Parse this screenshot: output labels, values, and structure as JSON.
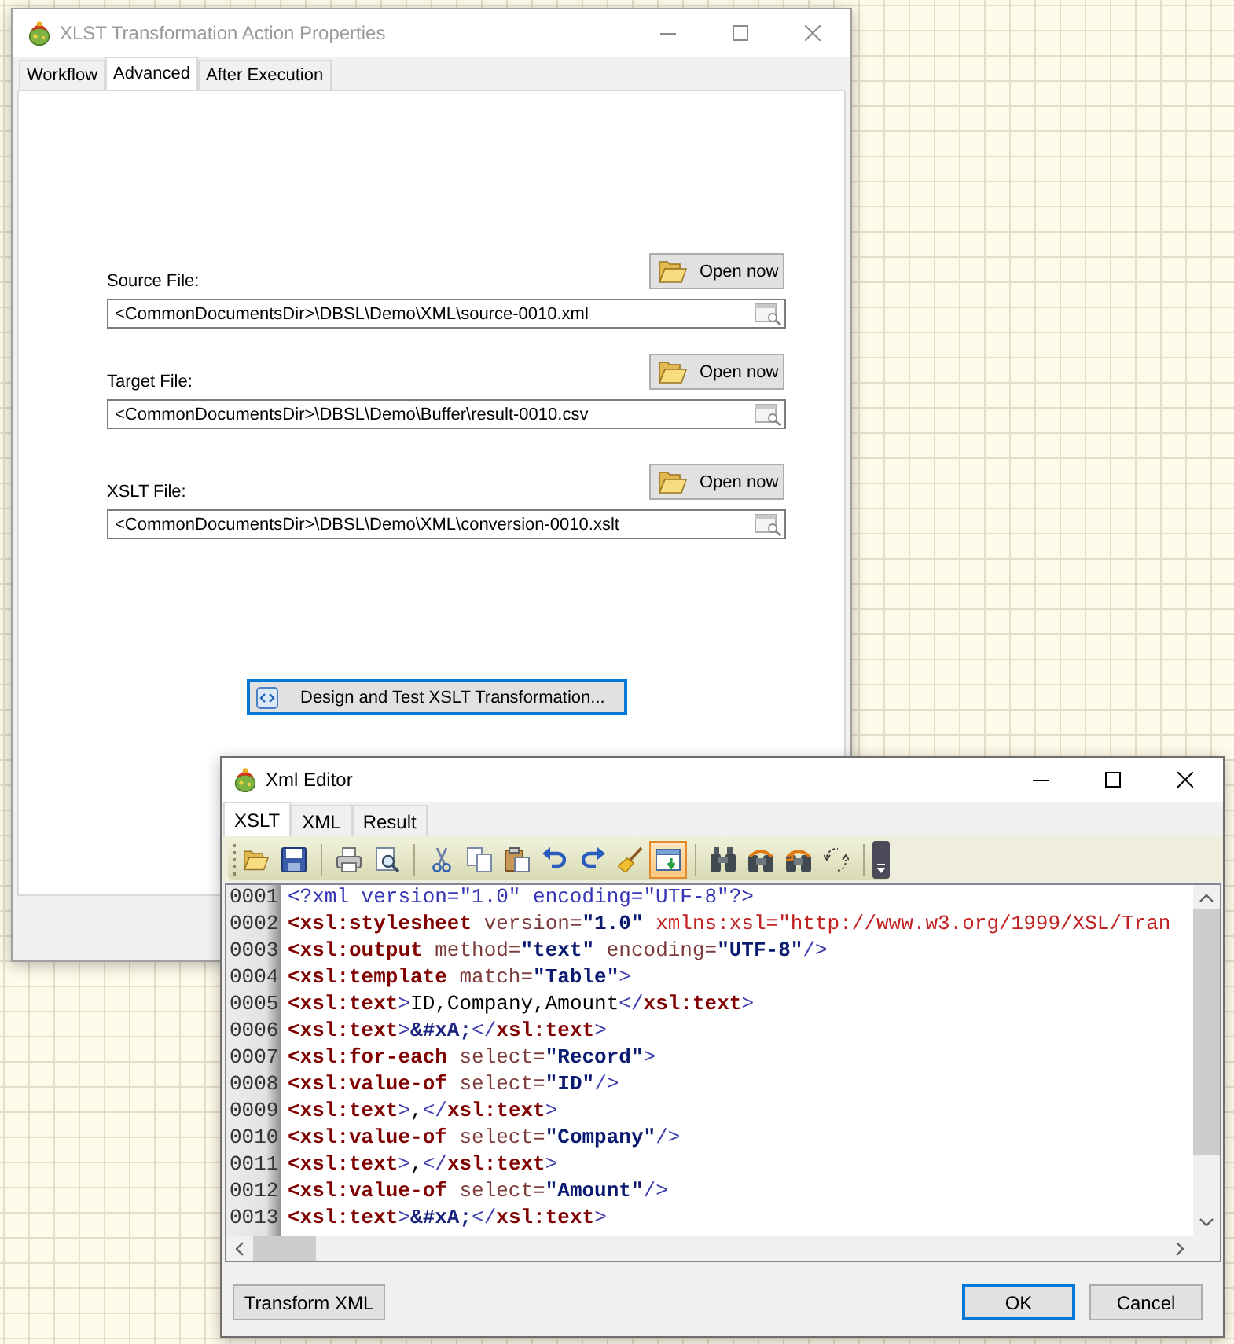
{
  "properties_window": {
    "title": "XLST Transformation Action Properties",
    "active": false,
    "tabs": [
      {
        "label": "Workflow",
        "selected": false
      },
      {
        "label": "Advanced",
        "selected": true
      },
      {
        "label": "After Execution",
        "selected": false
      }
    ],
    "files": [
      {
        "label": "Source File:",
        "button": "Open now",
        "value": "<CommonDocumentsDir>\\DBSL\\Demo\\XML\\source-0010.xml"
      },
      {
        "label": "Target File:",
        "button": "Open now",
        "value": "<CommonDocumentsDir>\\DBSL\\Demo\\Buffer\\result-0010.csv"
      },
      {
        "label": "XSLT File:",
        "button": "Open now",
        "value": "<CommonDocumentsDir>\\DBSL\\Demo\\XML\\conversion-0010.xslt"
      }
    ],
    "design_button": {
      "label": "Design and Test XSLT Transformation...",
      "focused": true
    }
  },
  "xml_editor": {
    "title": "Xml Editor",
    "active": true,
    "tabs": [
      {
        "label": "XSLT",
        "selected": true
      },
      {
        "label": "XML",
        "selected": false
      },
      {
        "label": "Result",
        "selected": false
      }
    ],
    "toolbar": {
      "toggle_checked": true
    },
    "lines": [
      {
        "number": "0001",
        "tokens": [
          {
            "kind": "pi",
            "text": "<?xml version=\"1.0\" encoding=\"UTF-8\"?>"
          }
        ]
      },
      {
        "number": "0002",
        "tokens": [
          {
            "kind": "tag",
            "text": "<xsl:stylesheet"
          },
          {
            "kind": "attr",
            "text": " version="
          },
          {
            "kind": "value",
            "text": "\"1.0\""
          },
          {
            "kind": "ns",
            "text": " xmlns:xsl=\"http://www.w3.org/1999/XSL/Tran"
          }
        ]
      },
      {
        "number": "0003",
        "tokens": [
          {
            "kind": "tag",
            "text": "<xsl:output"
          },
          {
            "kind": "attr",
            "text": " method="
          },
          {
            "kind": "value",
            "text": "\"text\""
          },
          {
            "kind": "attr",
            "text": " encoding="
          },
          {
            "kind": "value",
            "text": "\"UTF-8\""
          },
          {
            "kind": "bracket",
            "text": "/>"
          }
        ]
      },
      {
        "number": "0004",
        "tokens": [
          {
            "kind": "tag",
            "text": "<xsl:template"
          },
          {
            "kind": "attr",
            "text": " match="
          },
          {
            "kind": "value",
            "text": "\"Table\""
          },
          {
            "kind": "bracket",
            "text": ">"
          }
        ]
      },
      {
        "number": "0005",
        "tokens": [
          {
            "kind": "tag",
            "text": "<xsl:text"
          },
          {
            "kind": "bracket",
            "text": ">"
          },
          {
            "kind": "text",
            "text": "ID,Company,Amount"
          },
          {
            "kind": "bracket",
            "text": "</"
          },
          {
            "kind": "tag",
            "text": "xsl:text"
          },
          {
            "kind": "bracket",
            "text": ">"
          }
        ]
      },
      {
        "number": "0006",
        "tokens": [
          {
            "kind": "tag",
            "text": "<xsl:text"
          },
          {
            "kind": "bracket",
            "text": ">"
          },
          {
            "kind": "entity",
            "text": "&#xA;"
          },
          {
            "kind": "bracket",
            "text": "</"
          },
          {
            "kind": "tag",
            "text": "xsl:text"
          },
          {
            "kind": "bracket",
            "text": ">"
          }
        ]
      },
      {
        "number": "0007",
        "tokens": [
          {
            "kind": "tag",
            "text": "<xsl:for-each"
          },
          {
            "kind": "attr",
            "text": " select="
          },
          {
            "kind": "value",
            "text": "\"Record\""
          },
          {
            "kind": "bracket",
            "text": ">"
          }
        ]
      },
      {
        "number": "0008",
        "tokens": [
          {
            "kind": "tag",
            "text": "<xsl:value-of"
          },
          {
            "kind": "attr",
            "text": " select="
          },
          {
            "kind": "value",
            "text": "\"ID\""
          },
          {
            "kind": "bracket",
            "text": "/>"
          }
        ]
      },
      {
        "number": "0009",
        "tokens": [
          {
            "kind": "tag",
            "text": "<xsl:text"
          },
          {
            "kind": "bracket",
            "text": ">"
          },
          {
            "kind": "text",
            "text": ","
          },
          {
            "kind": "bracket",
            "text": "</"
          },
          {
            "kind": "tag",
            "text": "xsl:text"
          },
          {
            "kind": "bracket",
            "text": ">"
          }
        ]
      },
      {
        "number": "0010",
        "tokens": [
          {
            "kind": "tag",
            "text": "<xsl:value-of"
          },
          {
            "kind": "attr",
            "text": " select="
          },
          {
            "kind": "value",
            "text": "\"Company\""
          },
          {
            "kind": "bracket",
            "text": "/>"
          }
        ]
      },
      {
        "number": "0011",
        "tokens": [
          {
            "kind": "tag",
            "text": "<xsl:text"
          },
          {
            "kind": "bracket",
            "text": ">"
          },
          {
            "kind": "text",
            "text": ","
          },
          {
            "kind": "bracket",
            "text": "</"
          },
          {
            "kind": "tag",
            "text": "xsl:text"
          },
          {
            "kind": "bracket",
            "text": ">"
          }
        ]
      },
      {
        "number": "0012",
        "tokens": [
          {
            "kind": "tag",
            "text": "<xsl:value-of"
          },
          {
            "kind": "attr",
            "text": " select="
          },
          {
            "kind": "value",
            "text": "\"Amount\""
          },
          {
            "kind": "bracket",
            "text": "/>"
          }
        ]
      },
      {
        "number": "0013",
        "tokens": [
          {
            "kind": "tag",
            "text": "<xsl:text"
          },
          {
            "kind": "bracket",
            "text": ">"
          },
          {
            "kind": "entity",
            "text": "&#xA;"
          },
          {
            "kind": "bracket",
            "text": "</"
          },
          {
            "kind": "tag",
            "text": "xsl:text"
          },
          {
            "kind": "bracket",
            "text": ">"
          }
        ]
      }
    ],
    "footer": {
      "left_buttons": [
        {
          "label": "Transform XML",
          "focused": false
        }
      ],
      "right_buttons": [
        {
          "label": "OK",
          "focused": true
        },
        {
          "label": "Cancel",
          "focused": false
        }
      ]
    }
  }
}
